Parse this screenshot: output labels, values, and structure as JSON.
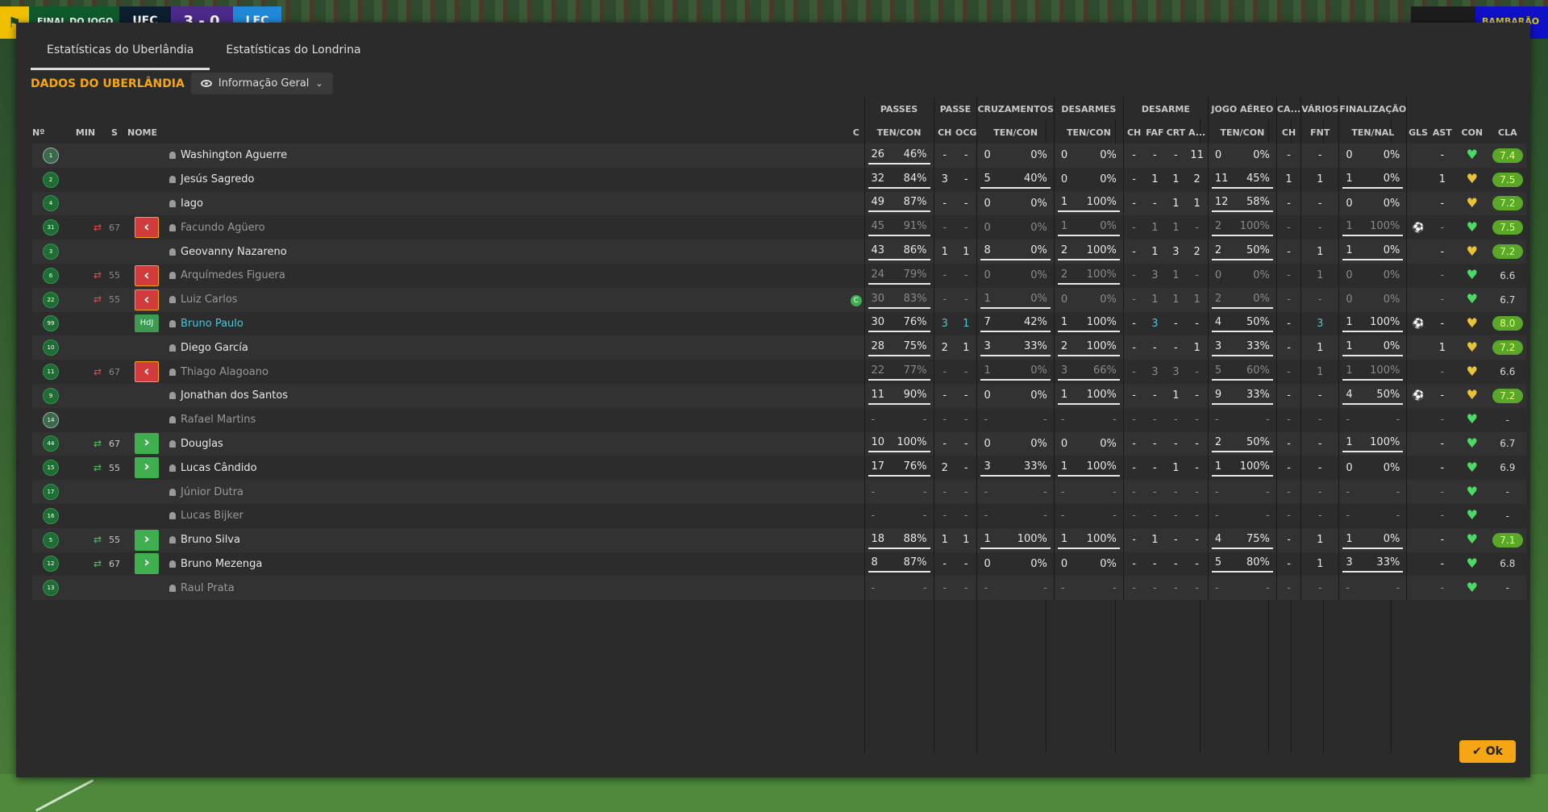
{
  "scorebar": {
    "label_final": "FINAL DO JOGO",
    "home": "UEC",
    "score": "3 - 0",
    "away": "LEC",
    "right_label": "BAMBARÃO"
  },
  "tabs": [
    {
      "label": "Estatísticas do Uberlândia"
    },
    {
      "label": "Estatísticas do Londrina"
    }
  ],
  "section_title": "DADOS DO UBERLÂNDIA",
  "view_dropdown": "Informação Geral",
  "groups": {
    "passes": "PASSES",
    "passe": "PASSE",
    "cruzamentos": "CRUZAMENTOS",
    "desarmes": "DESARMES",
    "desarme": "DESARME",
    "jogo_aereo": "JOGO AÉREO",
    "ca": "CA...",
    "varios": "VÁRIOS",
    "finalizacao": "FINALIZAÇÃO"
  },
  "columns": {
    "no": "Nº",
    "min": "MIN",
    "s": "S",
    "nome": "NOME",
    "c": "C",
    "ten_con": "TEN/CON",
    "ch": "CH",
    "ocg": "OCG",
    "faf": "FAF",
    "crt": "CRT",
    "a": "A...",
    "fnt": "FNT",
    "ten_nal": "TEN/NAL",
    "gls": "GLS",
    "ast": "AST",
    "con": "CON",
    "cla": "CLA"
  },
  "players": [
    {
      "no": "1",
      "gk": true,
      "min": "",
      "sub": "",
      "name": "Washington Aguerre",
      "cap": false,
      "p": [
        "26",
        "46%"
      ],
      "pch": "-",
      "pocg": "-",
      "cr": [
        "0",
        "0%"
      ],
      "ds": [
        "0",
        "0%"
      ],
      "dch": "-",
      "dfaf": "-",
      "dcrt": "-",
      "da": "11",
      "ja": [
        "0",
        "0%"
      ],
      "ca": "-",
      "fnt": "-",
      "fin": [
        "0",
        "0%"
      ],
      "gls": "",
      "ast": "-",
      "con": "g",
      "cla": "7.4"
    },
    {
      "no": "2",
      "min": "",
      "sub": "",
      "name": "Jesús Sagredo",
      "p": [
        "32",
        "84%"
      ],
      "pch": "3",
      "pocg": "-",
      "cr": [
        "5",
        "40%"
      ],
      "ds": [
        "0",
        "0%"
      ],
      "dch": "-",
      "dfaf": "1",
      "dcrt": "1",
      "da": "2",
      "ja": [
        "11",
        "45%"
      ],
      "ca": "1",
      "fnt": "1",
      "fin": [
        "1",
        "0%"
      ],
      "gls": "",
      "ast": "1",
      "con": "y",
      "cla": "7.5"
    },
    {
      "no": "4",
      "min": "",
      "sub": "",
      "name": "Iago",
      "p": [
        "49",
        "87%"
      ],
      "pch": "-",
      "pocg": "-",
      "cr": [
        "0",
        "0%"
      ],
      "ds": [
        "1",
        "100%"
      ],
      "dch": "-",
      "dfaf": "-",
      "dcrt": "1",
      "da": "1",
      "ja": [
        "12",
        "58%"
      ],
      "ca": "-",
      "fnt": "-",
      "fin": [
        "0",
        "0%"
      ],
      "gls": "",
      "ast": "-",
      "con": "y",
      "cla": "7.2"
    },
    {
      "no": "31",
      "min": "67",
      "sub": "out",
      "name": "Facundo Agüero",
      "dim": true,
      "p": [
        "45",
        "91%"
      ],
      "pch": "-",
      "pocg": "-",
      "cr": [
        "0",
        "0%"
      ],
      "ds": [
        "1",
        "0%"
      ],
      "dch": "-",
      "dfaf": "1",
      "dcrt": "1",
      "da": "-",
      "ja": [
        "2",
        "100%"
      ],
      "ca": "-",
      "fnt": "-",
      "fin": [
        "1",
        "100%"
      ],
      "gls": "ball",
      "ast": "-",
      "con": "g",
      "cla": "7.5"
    },
    {
      "no": "3",
      "min": "",
      "sub": "",
      "name": "Geovanny Nazareno",
      "p": [
        "43",
        "86%"
      ],
      "pch": "1",
      "pocg": "1",
      "cr": [
        "8",
        "0%"
      ],
      "ds": [
        "2",
        "100%"
      ],
      "dch": "-",
      "dfaf": "1",
      "dcrt": "3",
      "da": "2",
      "ja": [
        "2",
        "50%"
      ],
      "ca": "-",
      "fnt": "1",
      "fin": [
        "1",
        "0%"
      ],
      "gls": "",
      "ast": "-",
      "con": "y",
      "cla": "7.2"
    },
    {
      "no": "6",
      "min": "55",
      "sub": "out",
      "name": "Arquímedes Figuera",
      "dim": true,
      "p": [
        "24",
        "79%"
      ],
      "pch": "-",
      "pocg": "-",
      "cr": [
        "0",
        "0%"
      ],
      "ds": [
        "2",
        "100%"
      ],
      "dch": "-",
      "dfaf": "3",
      "dcrt": "1",
      "da": "-",
      "ja": [
        "0",
        "0%"
      ],
      "ca": "-",
      "fnt": "1",
      "fin": [
        "0",
        "0%"
      ],
      "gls": "",
      "ast": "-",
      "con": "g",
      "cla": "6.6"
    },
    {
      "no": "22",
      "min": "55",
      "sub": "out",
      "name": "Luiz Carlos",
      "dim": true,
      "cap": true,
      "p": [
        "30",
        "83%"
      ],
      "pch": "-",
      "pocg": "-",
      "cr": [
        "1",
        "0%"
      ],
      "ds": [
        "0",
        "0%"
      ],
      "dch": "-",
      "dfaf": "1",
      "dcrt": "1",
      "da": "1",
      "ja": [
        "2",
        "0%"
      ],
      "ca": "-",
      "fnt": "-",
      "fin": [
        "0",
        "0%"
      ],
      "gls": "",
      "ast": "-",
      "con": "g",
      "cla": "6.7"
    },
    {
      "no": "99",
      "min": "",
      "sub": "hdj",
      "name": "Bruno Paulo",
      "hdj": true,
      "p": [
        "30",
        "76%"
      ],
      "pch": "3",
      "pocg": "1",
      "cr": [
        "7",
        "42%"
      ],
      "ds": [
        "1",
        "100%"
      ],
      "dch": "-",
      "dfaf": "3",
      "dcrt": "-",
      "da": "-",
      "ja": [
        "4",
        "50%"
      ],
      "ca": "-",
      "fnt": "3",
      "fin": [
        "1",
        "100%"
      ],
      "gls": "ball",
      "ast": "-",
      "con": "y",
      "cla": "8.0"
    },
    {
      "no": "10",
      "min": "",
      "sub": "",
      "name": "Diego García",
      "p": [
        "28",
        "75%"
      ],
      "pch": "2",
      "pocg": "1",
      "cr": [
        "3",
        "33%"
      ],
      "ds": [
        "2",
        "100%"
      ],
      "dch": "-",
      "dfaf": "-",
      "dcrt": "-",
      "da": "1",
      "ja": [
        "3",
        "33%"
      ],
      "ca": "-",
      "fnt": "1",
      "fin": [
        "1",
        "0%"
      ],
      "gls": "",
      "ast": "1",
      "con": "y",
      "cla": "7.2"
    },
    {
      "no": "11",
      "min": "67",
      "sub": "out",
      "name": "Thiago Alagoano",
      "dim": true,
      "p": [
        "22",
        "77%"
      ],
      "pch": "-",
      "pocg": "-",
      "cr": [
        "1",
        "0%"
      ],
      "ds": [
        "3",
        "66%"
      ],
      "dch": "-",
      "dfaf": "3",
      "dcrt": "3",
      "da": "-",
      "ja": [
        "5",
        "60%"
      ],
      "ca": "-",
      "fnt": "1",
      "fin": [
        "1",
        "100%"
      ],
      "gls": "",
      "ast": "-",
      "con": "y",
      "cla": "6.6"
    },
    {
      "no": "9",
      "min": "",
      "sub": "",
      "name": "Jonathan dos Santos",
      "p": [
        "11",
        "90%"
      ],
      "pch": "-",
      "pocg": "-",
      "cr": [
        "0",
        "0%"
      ],
      "ds": [
        "1",
        "100%"
      ],
      "dch": "-",
      "dfaf": "-",
      "dcrt": "1",
      "da": "-",
      "ja": [
        "9",
        "33%"
      ],
      "ca": "-",
      "fnt": "-",
      "fin": [
        "4",
        "50%"
      ],
      "gls": "ball",
      "ast": "-",
      "con": "y",
      "cla": "7.2"
    },
    {
      "no": "14",
      "gk": true,
      "min": "",
      "sub": "",
      "name": "Rafael Martins",
      "dim": true,
      "p": [
        "-",
        "-"
      ],
      "pch": "-",
      "pocg": "-",
      "cr": [
        "-",
        "-"
      ],
      "ds": [
        "-",
        "-"
      ],
      "dch": "-",
      "dfaf": "-",
      "dcrt": "-",
      "da": "-",
      "ja": [
        "-",
        "-"
      ],
      "ca": "-",
      "fnt": "-",
      "fin": [
        "-",
        "-"
      ],
      "gls": "",
      "ast": "-",
      "con": "g",
      "cla": "-"
    },
    {
      "no": "44",
      "min": "67",
      "sub": "in",
      "name": "Douglas",
      "p": [
        "10",
        "100%"
      ],
      "pch": "-",
      "pocg": "-",
      "cr": [
        "0",
        "0%"
      ],
      "ds": [
        "0",
        "0%"
      ],
      "dch": "-",
      "dfaf": "-",
      "dcrt": "-",
      "da": "-",
      "ja": [
        "2",
        "50%"
      ],
      "ca": "-",
      "fnt": "-",
      "fin": [
        "1",
        "100%"
      ],
      "gls": "",
      "ast": "-",
      "con": "g",
      "cla": "6.7"
    },
    {
      "no": "15",
      "min": "55",
      "sub": "in",
      "name": "Lucas Cândido",
      "p": [
        "17",
        "76%"
      ],
      "pch": "2",
      "pocg": "-",
      "cr": [
        "3",
        "33%"
      ],
      "ds": [
        "1",
        "100%"
      ],
      "dch": "-",
      "dfaf": "-",
      "dcrt": "1",
      "da": "-",
      "ja": [
        "1",
        "100%"
      ],
      "ca": "-",
      "fnt": "-",
      "fin": [
        "0",
        "0%"
      ],
      "gls": "",
      "ast": "-",
      "con": "g",
      "cla": "6.9"
    },
    {
      "no": "17",
      "min": "",
      "sub": "",
      "name": "Júnior Dutra",
      "dim": true,
      "p": [
        "-",
        "-"
      ],
      "pch": "-",
      "pocg": "-",
      "cr": [
        "-",
        "-"
      ],
      "ds": [
        "-",
        "-"
      ],
      "dch": "-",
      "dfaf": "-",
      "dcrt": "-",
      "da": "-",
      "ja": [
        "-",
        "-"
      ],
      "ca": "-",
      "fnt": "-",
      "fin": [
        "-",
        "-"
      ],
      "gls": "",
      "ast": "-",
      "con": "g",
      "cla": "-"
    },
    {
      "no": "16",
      "min": "",
      "sub": "",
      "name": "Lucas Bijker",
      "dim": true,
      "p": [
        "-",
        "-"
      ],
      "pch": "-",
      "pocg": "-",
      "cr": [
        "-",
        "-"
      ],
      "ds": [
        "-",
        "-"
      ],
      "dch": "-",
      "dfaf": "-",
      "dcrt": "-",
      "da": "-",
      "ja": [
        "-",
        "-"
      ],
      "ca": "-",
      "fnt": "-",
      "fin": [
        "-",
        "-"
      ],
      "gls": "",
      "ast": "-",
      "con": "g",
      "cla": "-"
    },
    {
      "no": "5",
      "min": "55",
      "sub": "in",
      "name": "Bruno Silva",
      "p": [
        "18",
        "88%"
      ],
      "pch": "1",
      "pocg": "1",
      "cr": [
        "1",
        "100%"
      ],
      "ds": [
        "1",
        "100%"
      ],
      "dch": "-",
      "dfaf": "1",
      "dcrt": "-",
      "da": "-",
      "ja": [
        "4",
        "75%"
      ],
      "ca": "-",
      "fnt": "1",
      "fin": [
        "1",
        "0%"
      ],
      "gls": "",
      "ast": "-",
      "con": "g",
      "cla": "7.1"
    },
    {
      "no": "12",
      "min": "67",
      "sub": "in",
      "name": "Bruno Mezenga",
      "p": [
        "8",
        "87%"
      ],
      "pch": "-",
      "pocg": "-",
      "cr": [
        "0",
        "0%"
      ],
      "ds": [
        "0",
        "0%"
      ],
      "dch": "-",
      "dfaf": "-",
      "dcrt": "-",
      "da": "-",
      "ja": [
        "5",
        "80%"
      ],
      "ca": "-",
      "fnt": "1",
      "fin": [
        "3",
        "33%"
      ],
      "gls": "",
      "ast": "-",
      "con": "g",
      "cla": "6.8"
    },
    {
      "no": "13",
      "min": "",
      "sub": "",
      "name": "Raul Prata",
      "dim": true,
      "p": [
        "-",
        "-"
      ],
      "pch": "-",
      "pocg": "-",
      "cr": [
        "-",
        "-"
      ],
      "ds": [
        "-",
        "-"
      ],
      "dch": "-",
      "dfaf": "-",
      "dcrt": "-",
      "da": "-",
      "ja": [
        "-",
        "-"
      ],
      "ca": "-",
      "fnt": "-",
      "fin": [
        "-",
        "-"
      ],
      "gls": "",
      "ast": "-",
      "con": "g",
      "cla": "-"
    }
  ],
  "ok_button": "Ok",
  "icons": {
    "sub_out": "sub-out-icon",
    "sub_in": "sub-in-icon",
    "goal": "ball-icon",
    "condition": "heart-icon",
    "captain": "captain-badge"
  },
  "colors": {
    "accent": "#f4a614",
    "rating_bg": "#5aa829",
    "heart_green": "#4cd964",
    "heart_yellow": "#e8c23a",
    "hdj": "#4fc3d7",
    "sub_out": "#d23b3b",
    "sub_in": "#3fae4f"
  },
  "labels": {
    "hdj": "HdJ",
    "captain": "C"
  }
}
